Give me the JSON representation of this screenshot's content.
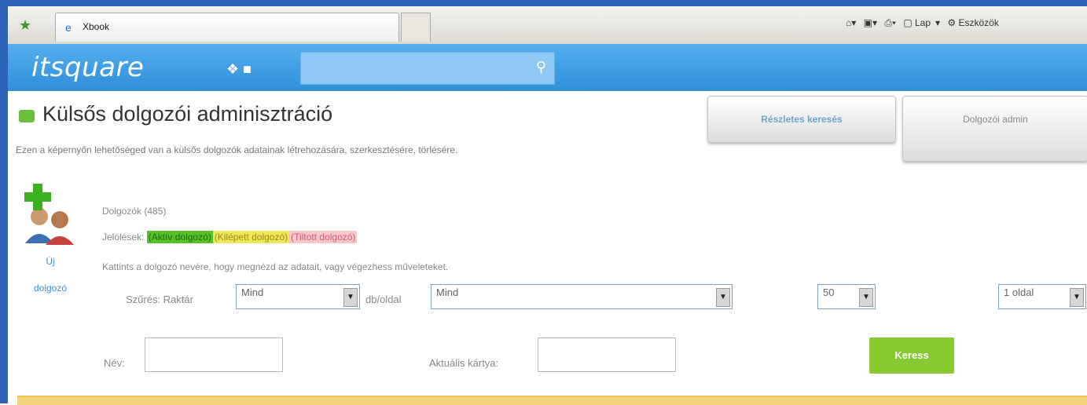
{
  "browser": {
    "tab_title": "Xbook",
    "toolbar_items": [
      "Lap",
      "Eszközök"
    ]
  },
  "header": {
    "logo": "itsquare",
    "search_placeholder": ""
  },
  "page": {
    "title": "Külsős dolgozói adminisztráció",
    "description": "Ezen a képernyőn lehetőséged van a külsős dolgozók adatainak létrehozására, szerkesztésére, törlésére.",
    "tabs": {
      "detailed_search": "Részletes keresés",
      "worker_admin": "Dolgozói admin"
    },
    "new_worker": {
      "line1": "Új",
      "line2": "dolgozó"
    },
    "worker_count": "Dolgozók (485)",
    "legend": {
      "label": "Jelölések:",
      "active": "(Aktív dolgozó)",
      "left": "(Kilépett dolgozó)",
      "banned": "(Tiltott dolgozó)"
    },
    "hint": "Kattints a dolgozó nevére, hogy megnézd az adatait, vagy végezhess műveleteket."
  },
  "filters": {
    "label": "Szűrés: Raktár",
    "warehouse_value": "Mind",
    "per_page_label": "db/oldal",
    "second_value": "Mind",
    "per_page_value": "50",
    "page_value": "1 oldal"
  },
  "search_form": {
    "name_label": "Név:",
    "card_label": "Aktuális kártya:",
    "search_button": "Keress"
  },
  "colors": {
    "header_blue": "#2f8fd8",
    "search_green": "#86c931",
    "legend_green": "#5ac02a",
    "legend_yellow": "#ede85a",
    "legend_pink": "#f8c7cc"
  }
}
